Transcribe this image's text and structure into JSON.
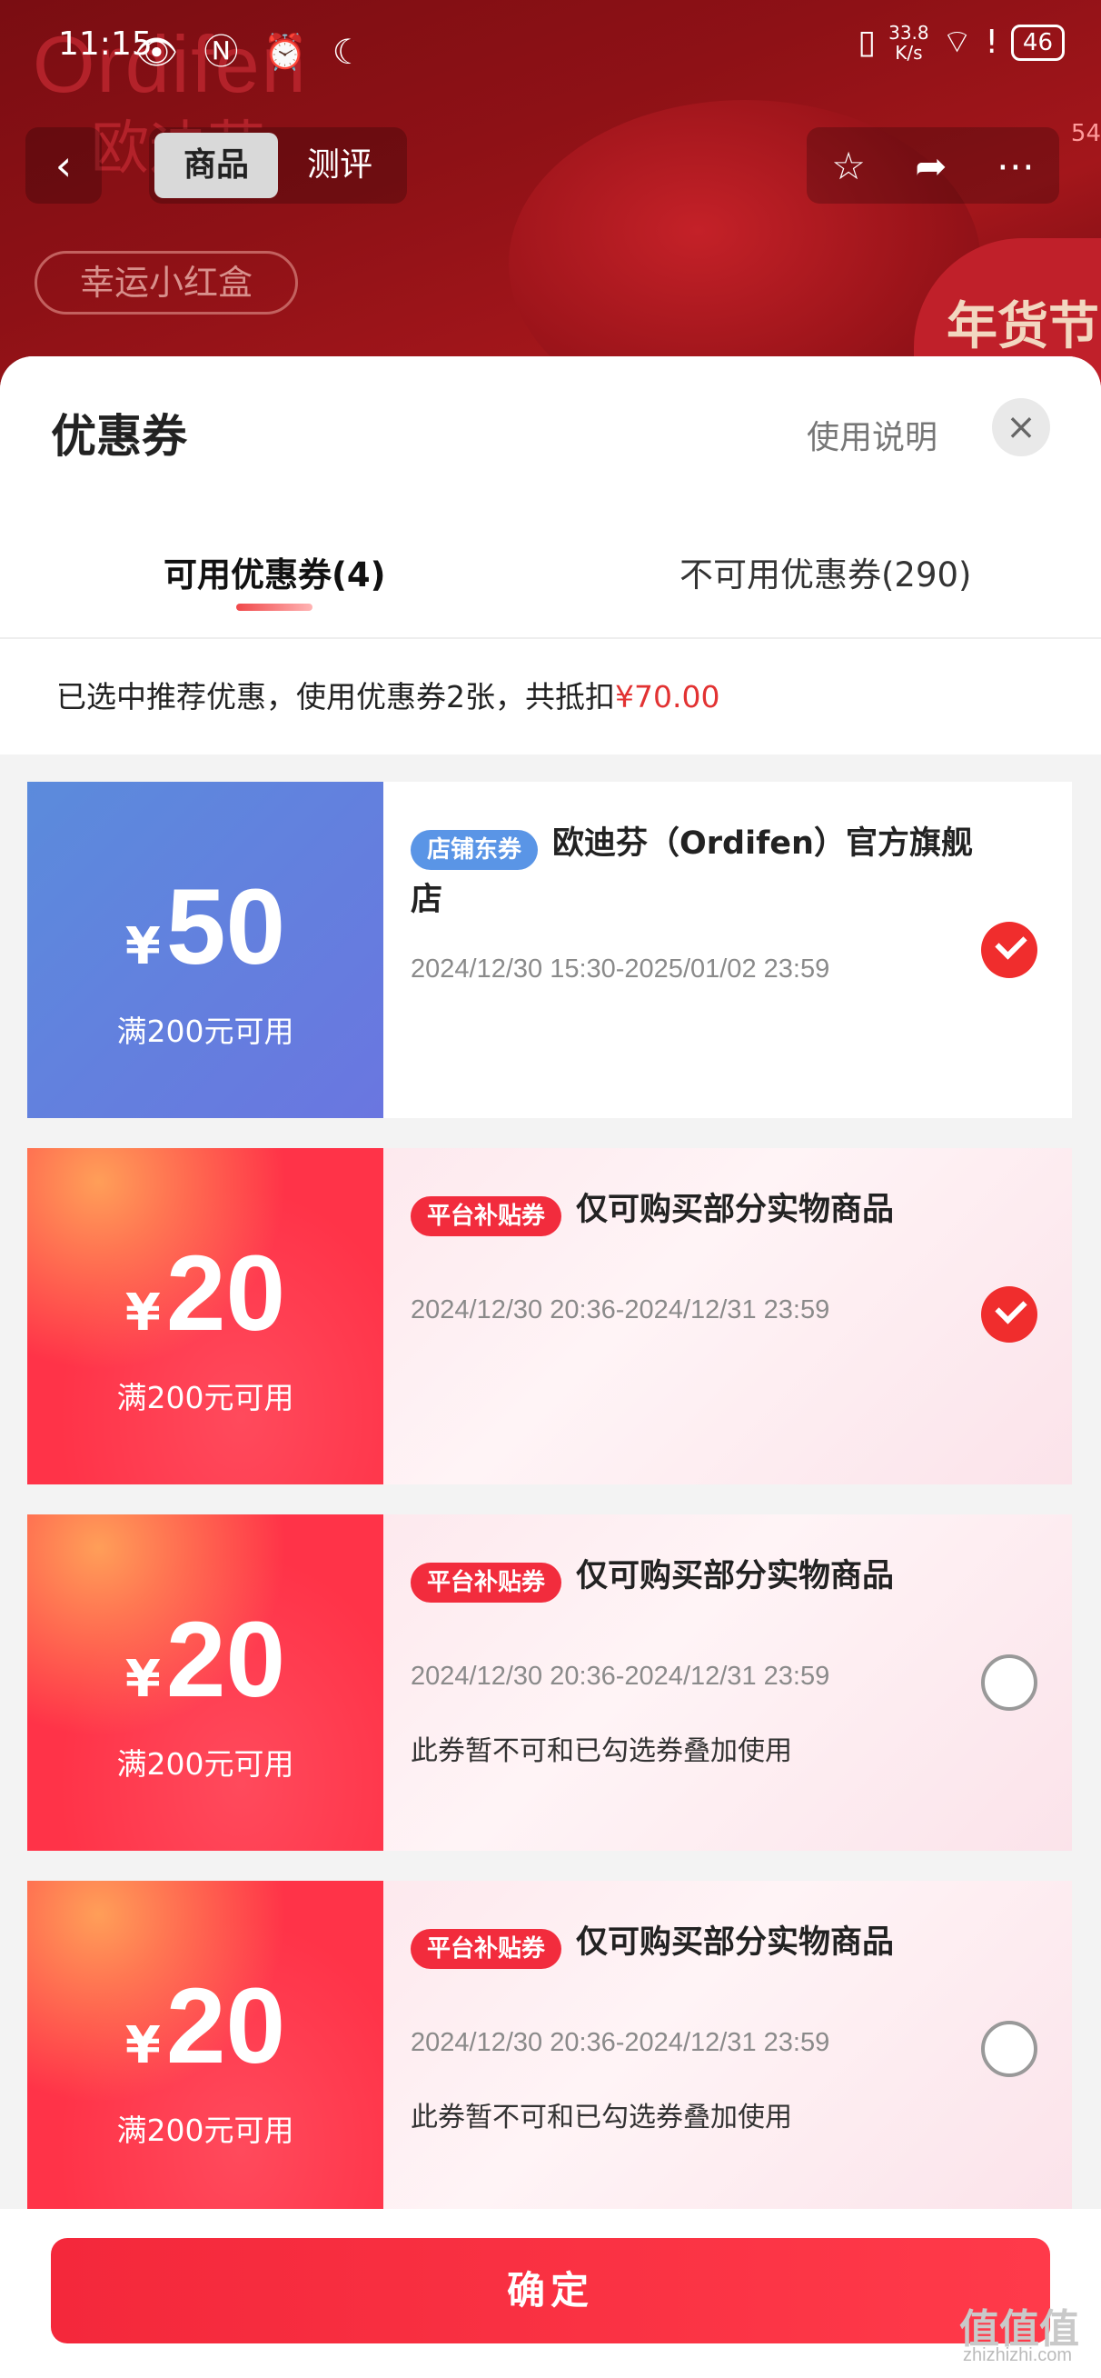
{
  "status_bar": {
    "time": "11:15",
    "left_icons": "👁 Ⓝ ⏰ ☾",
    "net_speed_value": "33.8",
    "net_speed_unit": "K/s",
    "battery": "46"
  },
  "background": {
    "brand": "Ordifen",
    "brand_cn": "欧迪芬",
    "pill": "幸运小红盒",
    "festival": "年货节"
  },
  "nav": {
    "back": "‹",
    "tabs": [
      {
        "label": "商品",
        "active": true
      },
      {
        "label": "测评",
        "active": false
      }
    ],
    "icons": [
      "star-icon",
      "share-icon",
      "more-icon"
    ],
    "badge": "54"
  },
  "sheet": {
    "title": "优惠券",
    "help": "使用说明",
    "close": "×",
    "tabs": [
      {
        "label": "可用优惠券(4)",
        "active": true
      },
      {
        "label": "不可用优惠券(290)",
        "active": false
      }
    ],
    "summary_prefix": "已选中推荐优惠，使用优惠券2张，共抵扣",
    "summary_amount": "¥70.00"
  },
  "coupons": [
    {
      "symbol": "¥",
      "value": "50",
      "threshold": "满200元可用",
      "tag": "店铺东券",
      "title": "欧迪芬（Ordifen）官方旗舰店",
      "date": "2024/12/30 15:30-2025/01/02 23:59",
      "note": "",
      "selected": true
    },
    {
      "symbol": "¥",
      "value": "20",
      "threshold": "满200元可用",
      "tag": "平台补贴券",
      "title": "仅可购买部分实物商品",
      "date": "2024/12/30 20:36-2024/12/31 23:59",
      "note": "",
      "selected": true
    },
    {
      "symbol": "¥",
      "value": "20",
      "threshold": "满200元可用",
      "tag": "平台补贴券",
      "title": "仅可购买部分实物商品",
      "date": "2024/12/30 20:36-2024/12/31 23:59",
      "note": "此券暂不可和已勾选券叠加使用",
      "selected": false
    },
    {
      "symbol": "¥",
      "value": "20",
      "threshold": "满200元可用",
      "tag": "平台补贴券",
      "title": "仅可购买部分实物商品",
      "date": "2024/12/30 20:36-2024/12/31 23:59",
      "note": "此券暂不可和已勾选券叠加使用",
      "selected": false
    }
  ],
  "confirm_label": "确定",
  "watermark": {
    "logo": "值值值",
    "site": "zhizhizhi.com"
  }
}
